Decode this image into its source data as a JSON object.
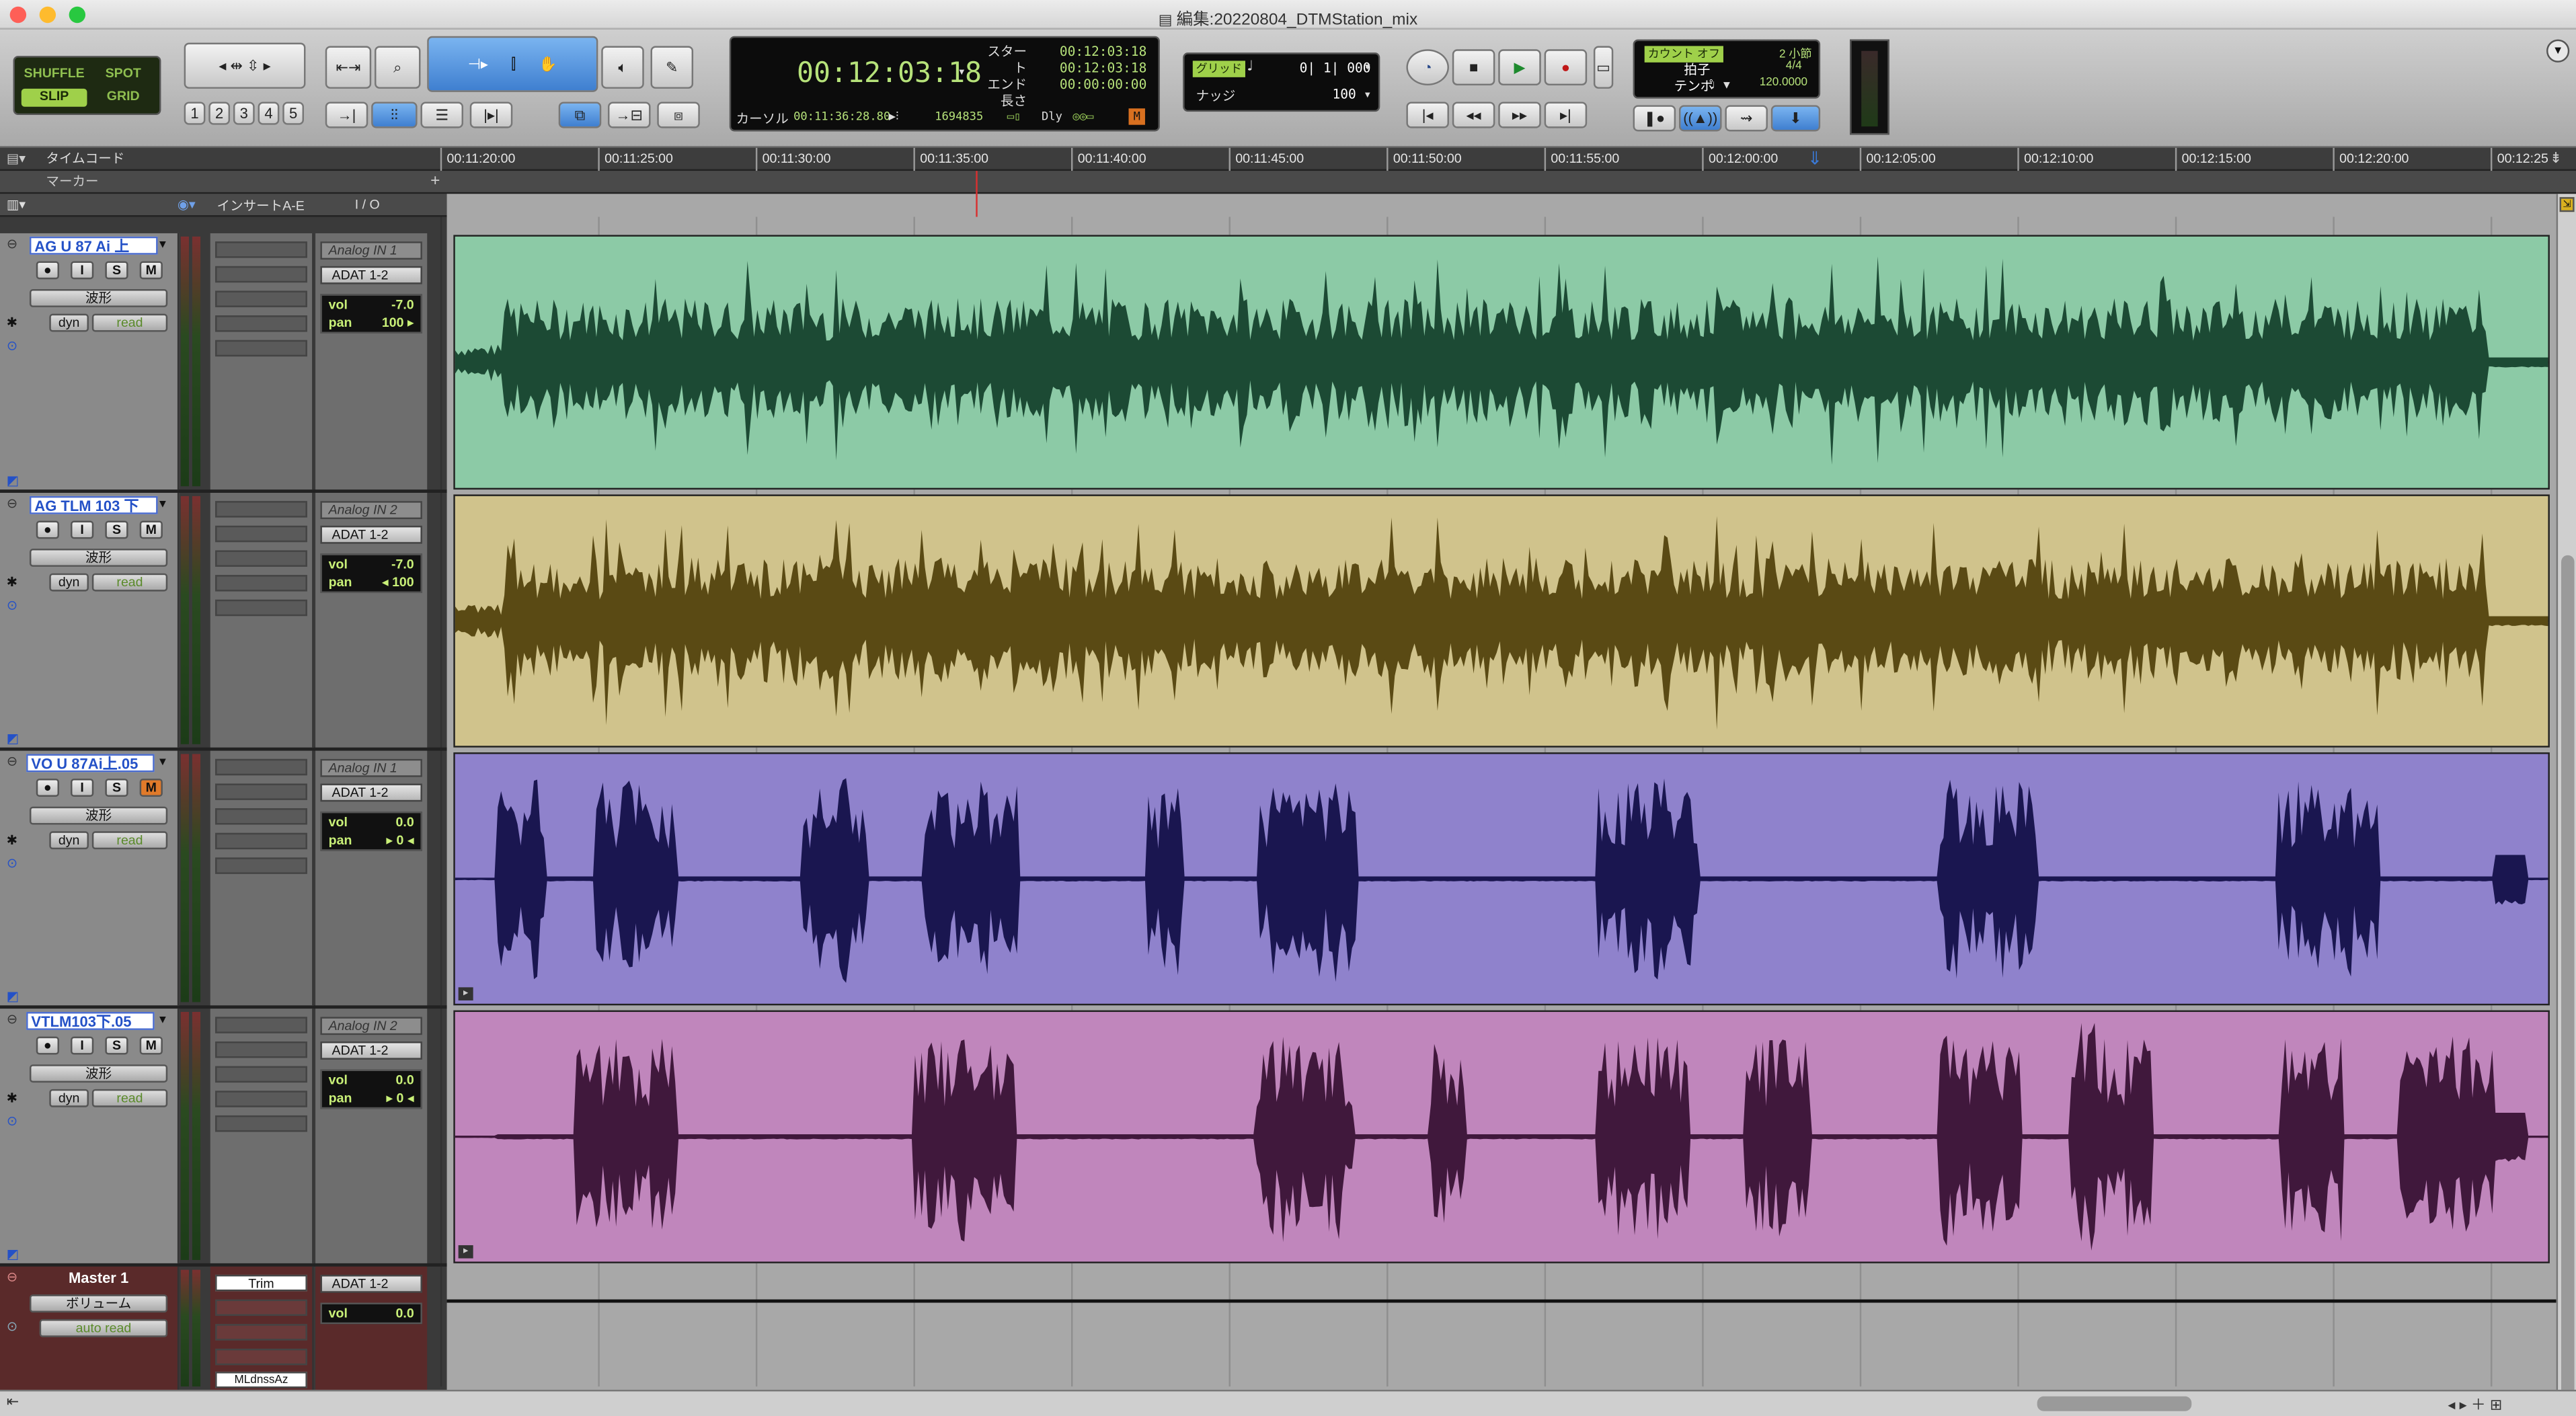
{
  "window": {
    "title": "編集:20220804_DTMStation_mix"
  },
  "edit_modes": {
    "shuffle": "SHUFFLE",
    "spot": "SPOT",
    "slip": "SLIP",
    "grid": "GRID"
  },
  "zoom_presets": [
    "1",
    "2",
    "3",
    "4",
    "5"
  ],
  "counter": {
    "main": "00:12:03:18",
    "start_label": "スタート",
    "start": "00:12:03:18",
    "end_label": "エンド",
    "end": "00:12:03:18",
    "length_label": "長さ",
    "length": "00:00:00:00",
    "cursor_label": "カーソル",
    "cursor": "00:11:36:28.80",
    "sample": "1694835",
    "dly": "Dly",
    "m_flag": "M"
  },
  "grid": {
    "label": "グリッド",
    "value": "0| 1| 000",
    "nudge_label": "ナッジ",
    "nudge": "100"
  },
  "midi": {
    "count_off": "カウント オフ",
    "bars": "2 小節",
    "meter_label": "拍子",
    "meter": "4/4",
    "tempo_label": "テンポ",
    "tempo": "120.0000"
  },
  "rulers": {
    "timecode_label": "タイムコード",
    "marker_label": "マーカー",
    "ticks": [
      "00:11:20:00",
      "00:11:25:00",
      "00:11:30:00",
      "00:11:35:00",
      "00:11:40:00",
      "00:11:45:00",
      "00:11:50:00",
      "00:11:55:00",
      "00:12:00:00",
      "00:12:05:00",
      "00:12:10:00",
      "00:12:15:00",
      "00:12:20:00",
      "00:12:25"
    ]
  },
  "columns": {
    "inserts": "インサートA-E",
    "io": "I / O"
  },
  "tracks": [
    {
      "name": "AG U 87 Ai 上",
      "view": "波形",
      "dyn": "dyn",
      "auto": "read",
      "input": "Analog IN 1",
      "output": "ADAT 1-2",
      "vol_label": "vol",
      "vol": "-7.0",
      "pan_label": "pan",
      "pan": "100 ▸",
      "color": "#8ccaa6",
      "wave": "#1c4a34"
    },
    {
      "name": "AG TLM 103 下",
      "view": "波形",
      "dyn": "dyn",
      "auto": "read",
      "input": "Analog IN 2",
      "output": "ADAT 1-2",
      "vol_label": "vol",
      "vol": "-7.0",
      "pan_label": "pan",
      "pan": "◂ 100",
      "color": "#d0c38c",
      "wave": "#5a4a14"
    },
    {
      "name": "VO U 87Ai上.05",
      "view": "波形",
      "dyn": "dyn",
      "auto": "read",
      "input": "Analog IN 1",
      "output": "ADAT 1-2",
      "vol_label": "vol",
      "vol": "0.0",
      "pan_label": "pan",
      "pan": "▸ 0 ◂",
      "color": "#8f82cc",
      "wave": "#1a1650"
    },
    {
      "name": "VTLM103下.05",
      "view": "波形",
      "dyn": "dyn",
      "auto": "read",
      "input": "Analog IN 2",
      "output": "ADAT 1-2",
      "vol_label": "vol",
      "vol": "0.0",
      "pan_label": "pan",
      "pan": "▸ 0 ◂",
      "color": "#c086bc",
      "wave": "#40183c"
    }
  ],
  "master": {
    "name": "Master 1",
    "view": "ボリューム",
    "auto": "auto read",
    "insert1": "Trim",
    "insert5": "MLdnssAz",
    "output": "ADAT 1-2",
    "vol_label": "vol",
    "vol": "0.0"
  },
  "track_buttons": {
    "rec": "●",
    "input": "I",
    "solo": "S",
    "mute": "M"
  },
  "colors": {
    "selection_name": "#2451c7",
    "mute_active": "#e07a2a",
    "lcd_green": "#9cd05a"
  }
}
